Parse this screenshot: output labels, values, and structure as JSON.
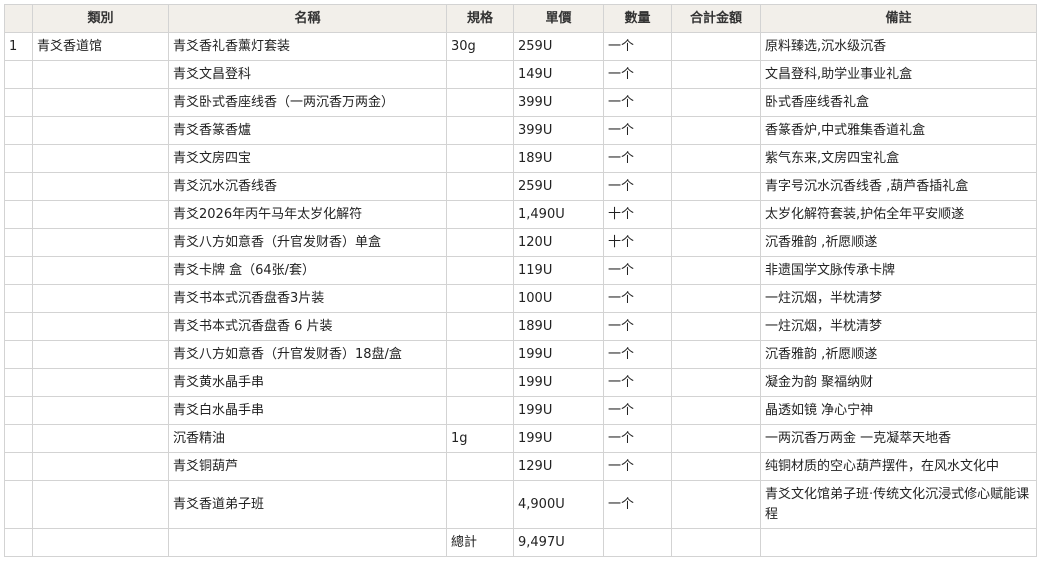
{
  "headers": [
    "",
    "類別",
    "名稱",
    "規格",
    "單價",
    "數量",
    "合計金額",
    "備註"
  ],
  "rows": [
    {
      "no": "1",
      "category": "青爻香道馆",
      "name": "青爻香礼香薰灯套装",
      "spec": "30g",
      "price": "259U",
      "qty": "一个",
      "total": "",
      "note": "原料臻选,沉水级沉香"
    },
    {
      "no": "",
      "category": "",
      "name": "青爻文昌登科",
      "spec": "",
      "price": "149U",
      "qty": "一个",
      "total": "",
      "note": "文昌登科,助学业事业礼盒"
    },
    {
      "no": "",
      "category": "",
      "name": "青爻卧式香座线香（一两沉香万两金）",
      "spec": "",
      "price": "399U",
      "qty": "一个",
      "total": "",
      "note": "卧式香座线香礼盒"
    },
    {
      "no": "",
      "category": "",
      "name": "青爻香篆香爐",
      "spec": "",
      "price": "399U",
      "qty": "一个",
      "total": "",
      "note": "香篆香炉,中式雅集香道礼盒"
    },
    {
      "no": "",
      "category": "",
      "name": "青爻文房四宝",
      "spec": "",
      "price": "189U",
      "qty": "一个",
      "total": "",
      "note": "紫气东来,文房四宝礼盒"
    },
    {
      "no": "",
      "category": "",
      "name": "青爻沉水沉香线香",
      "spec": "",
      "price": "259U",
      "qty": "一个",
      "total": "",
      "note": "青字号沉水沉香线香 ,葫芦香插礼盒"
    },
    {
      "no": "",
      "category": "",
      "name": "青爻2026年丙午马年太岁化解符",
      "spec": "",
      "price": "1,490U",
      "qty": "十个",
      "total": "",
      "note": "太岁化解符套装,护佑全年平安顺遂"
    },
    {
      "no": "",
      "category": "",
      "name": "青爻八方如意香（升官发财香）单盒",
      "spec": "",
      "price": "120U",
      "qty": "十个",
      "total": "",
      "note": "沉香雅韵 ,祈愿顺遂"
    },
    {
      "no": "",
      "category": "",
      "name": "青爻卡牌 盒（64张/套）",
      "spec": "",
      "price": "119U",
      "qty": "一个",
      "total": "",
      "note": "非遗国学文脉传承卡牌"
    },
    {
      "no": "",
      "category": "",
      "name": "青爻书本式沉香盘香3片装",
      "spec": "",
      "price": "100U",
      "qty": "一个",
      "total": "",
      "note": "一炷沉烟，半枕清梦"
    },
    {
      "no": "",
      "category": "",
      "name": "青爻书本式沉香盘香 6 片装",
      "spec": "",
      "price": "189U",
      "qty": "一个",
      "total": "",
      "note": "一炷沉烟，半枕清梦"
    },
    {
      "no": "",
      "category": "",
      "name": "青爻八方如意香（升官发财香）18盘/盒",
      "spec": "",
      "price": "199U",
      "qty": "一个",
      "total": "",
      "note": "沉香雅韵 ,祈愿顺遂"
    },
    {
      "no": "",
      "category": "",
      "name": "青爻黄水晶手串",
      "spec": "",
      "price": "199U",
      "qty": "一个",
      "total": "",
      "note": "凝金为韵 聚福纳财"
    },
    {
      "no": "",
      "category": "",
      "name": "青爻白水晶手串",
      "spec": "",
      "price": "199U",
      "qty": "一个",
      "total": "",
      "note": "晶透如镜 净心宁神"
    },
    {
      "no": "",
      "category": "",
      "name": "沉香精油",
      "spec": "1g",
      "price": "199U",
      "qty": "一个",
      "total": "",
      "note": "一两沉香万两金 一克凝萃天地香"
    },
    {
      "no": "",
      "category": "",
      "name": "青爻铜葫芦",
      "spec": "",
      "price": "129U",
      "qty": "一个",
      "total": "",
      "note": "纯铜材质的空心葫芦摆件，在风水文化中"
    },
    {
      "no": "",
      "category": "",
      "name": "青爻香道弟子班",
      "spec": "",
      "price": "4,900U",
      "qty": "一个",
      "total": "",
      "note": "青爻文化馆弟子班·传统文化沉浸式修心赋能课程"
    }
  ],
  "footer": {
    "label": "總計",
    "amount": "9,497U"
  }
}
